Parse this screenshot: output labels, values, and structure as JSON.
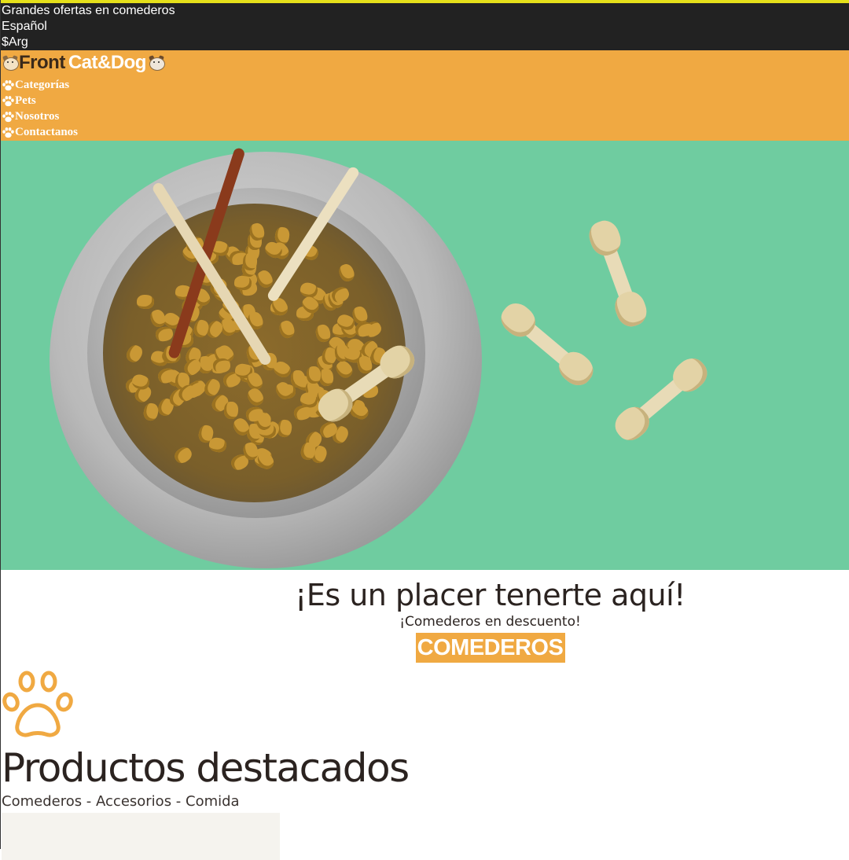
{
  "topbar": {
    "promo": "Grandes ofertas en comederos",
    "language": "Español",
    "currency": "$Arg"
  },
  "brand": {
    "part1": "Front",
    "part2": "Cat&Dog",
    "icon_left": "cat-face-icon",
    "icon_right": "dog-face-icon"
  },
  "nav": {
    "items": [
      {
        "label": "Categorías",
        "icon": "paw-icon"
      },
      {
        "label": "Pets",
        "icon": "paw-icon"
      },
      {
        "label": "Nosotros",
        "icon": "paw-icon"
      },
      {
        "label": "Contactanos",
        "icon": "paw-icon"
      }
    ]
  },
  "hero": {
    "image": "pet-food-bowl-with-bones"
  },
  "welcome": {
    "title": "¡Es un placer tenerte aquí!",
    "subtitle": "¡Comederos en descuento!",
    "cta_label": "COMEDEROS"
  },
  "featured": {
    "icon": "paw-icon",
    "title": "Productos destacados",
    "links": "Comederos - Accesorios - Comida"
  },
  "colors": {
    "accent": "#f0a942",
    "topbar_bg": "#222222",
    "topbar_border": "#e5e01a",
    "hero_bg": "#6fcca0",
    "text_dark": "#2b2320"
  }
}
